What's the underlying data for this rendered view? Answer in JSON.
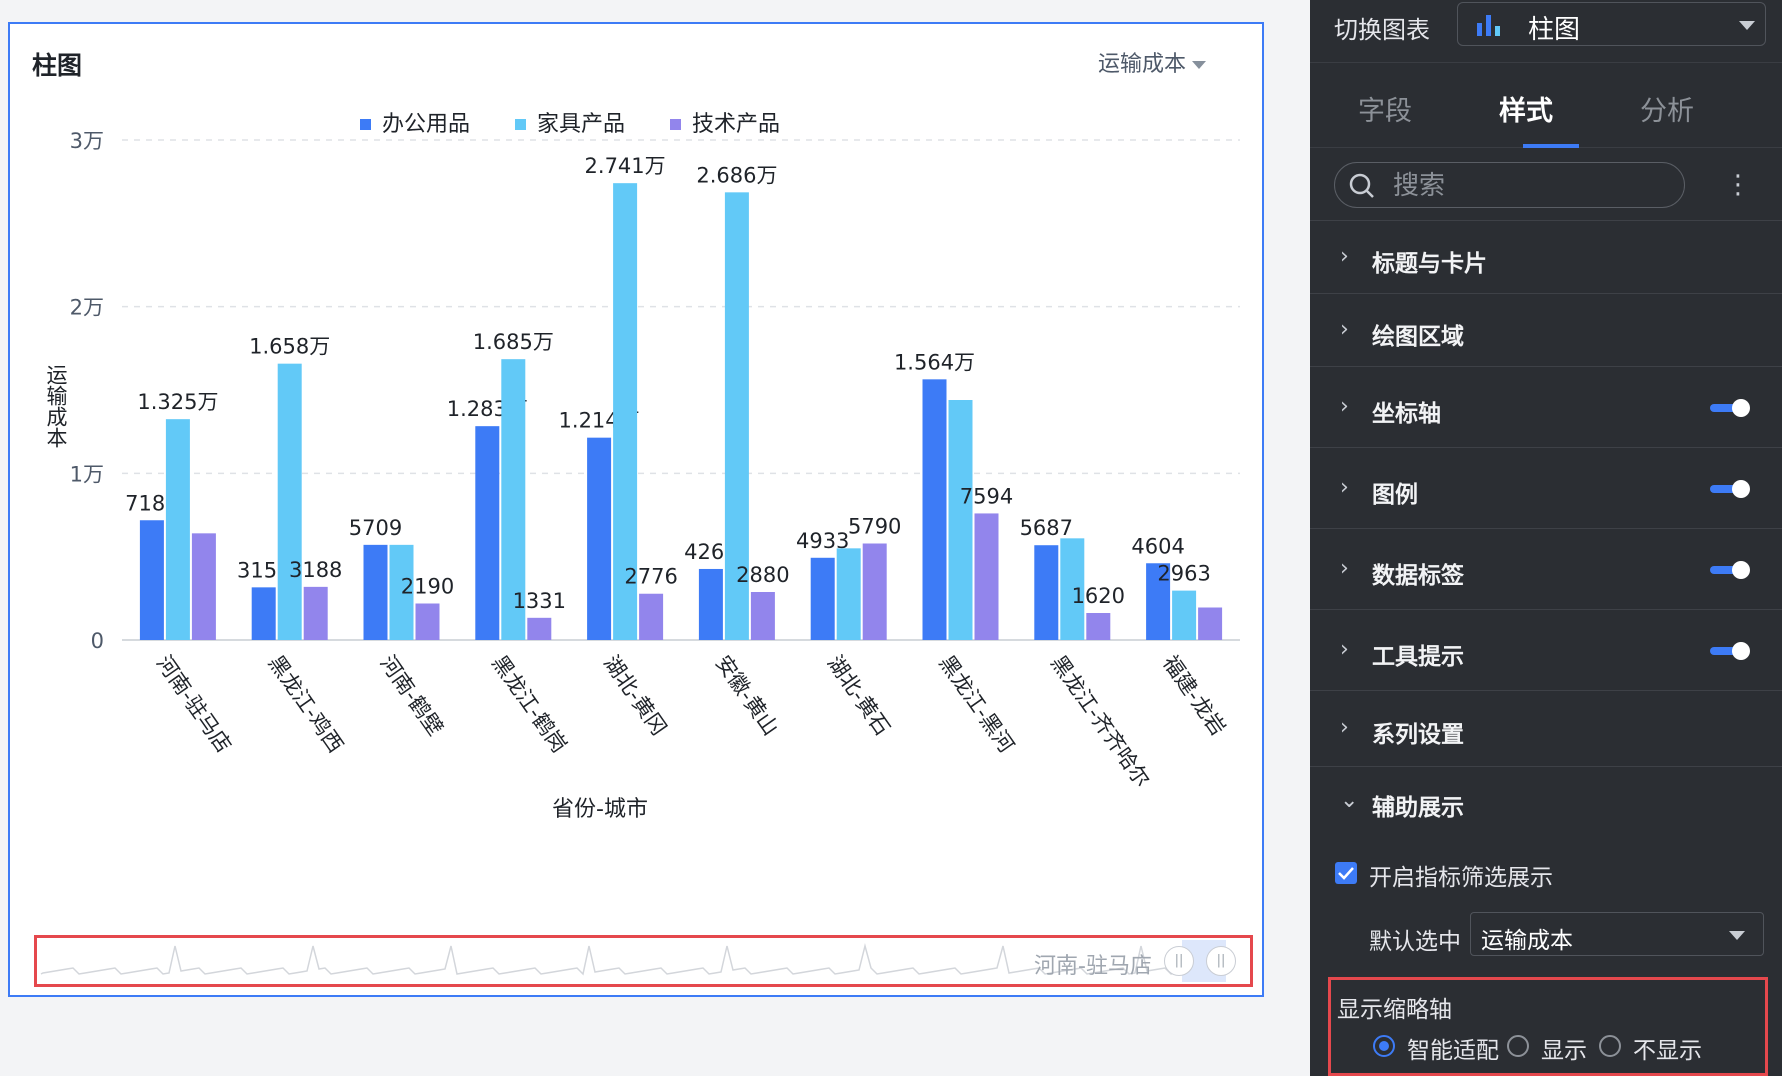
{
  "card": {
    "title": "柱图",
    "metric_select": "运输成本"
  },
  "chart_data": {
    "type": "bar",
    "categories": [
      "河南-驻马店",
      "黑龙江-鸡西",
      "河南-鹤壁",
      "黑龙江-鹤岗",
      "湖北-黄冈",
      "安徽-黄山",
      "湖北-黄石",
      "黑龙江-黑河",
      "黑龙江-齐齐哈尔",
      "福建-龙岩"
    ],
    "series": [
      {
        "name": "办公用品",
        "color": "#3d7bf6",
        "values": [
          7185,
          3159,
          5709,
          12830,
          12140,
          4262,
          4933,
          15640,
          5687,
          4604
        ],
        "labels": [
          "7185",
          "3159",
          "5709",
          "1.283万",
          "1.214万",
          "4262",
          "4933",
          "1.564万",
          "5687",
          "4604"
        ]
      },
      {
        "name": "家具产品",
        "color": "#62c9f7",
        "values": [
          13250,
          16580,
          5709,
          16850,
          27410,
          26860,
          5500,
          14400,
          6100,
          2963
        ],
        "labels": [
          "1.325万",
          "1.658万",
          "",
          "1.685万",
          "2.741万",
          "2.686万",
          "",
          "",
          "",
          "2963"
        ]
      },
      {
        "name": "技术产品",
        "color": "#9285ec",
        "values": [
          6400,
          3188,
          2190,
          1331,
          2776,
          2880,
          5790,
          7594,
          1620,
          1950
        ],
        "labels": [
          "",
          "3188",
          "2190",
          "1331",
          "2776",
          "2880",
          "5790",
          "7594",
          "1620",
          ""
        ]
      }
    ],
    "yticks": [
      "0",
      "1万",
      "2万",
      "3万"
    ],
    "ylim": [
      0,
      30000
    ],
    "ylabel": "运输成本",
    "xlabel": "省份-城市",
    "legend_position": "top",
    "grid": true,
    "thumbnail_label": "河南-驻马店"
  },
  "panel": {
    "switch_label": "切换图表",
    "switch_value": "柱图",
    "tabs": [
      "字段",
      "样式",
      "分析"
    ],
    "active_tab": 1,
    "search_placeholder": "搜索",
    "sections": [
      {
        "title": "标题与卡片",
        "toggle": false
      },
      {
        "title": "绘图区域",
        "toggle": false
      },
      {
        "title": "坐标轴",
        "toggle": true
      },
      {
        "title": "图例",
        "toggle": true
      },
      {
        "title": "数据标签",
        "toggle": true
      },
      {
        "title": "工具提示",
        "toggle": true
      },
      {
        "title": "系列设置",
        "toggle": false
      },
      {
        "title": "辅助展示",
        "toggle": false,
        "expanded": true
      }
    ],
    "checkbox_label": "开启指标筛选展示",
    "checkbox_checked": true,
    "default_label": "默认选中",
    "default_value": "运输成本",
    "thumb_title": "显示缩略轴",
    "radio_options": [
      "智能适配",
      "显示",
      "不显示"
    ],
    "radio_selected": 0
  }
}
